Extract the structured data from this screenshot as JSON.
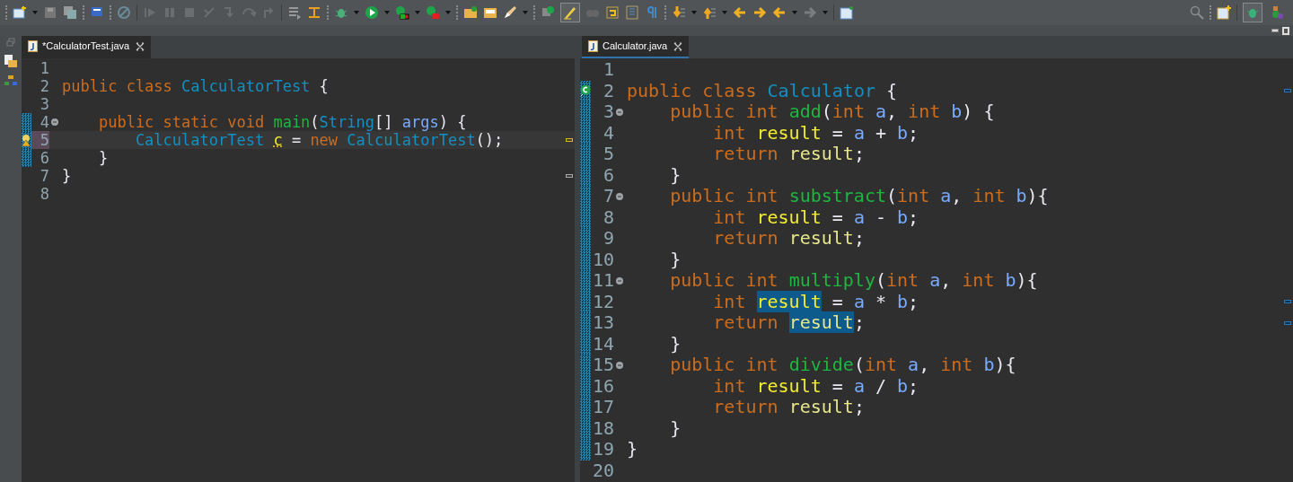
{
  "toolbar": {
    "mark_occurrences": {
      "on": true
    },
    "perspectives": [
      {
        "selected": true
      },
      {
        "selected": false
      }
    ]
  },
  "editors": [
    {
      "tab": {
        "title": "*CalculatorTest.java",
        "active": false
      },
      "kind": "narrow",
      "lines": [
        {
          "number": "1"
        },
        {
          "number": "2",
          "tokens": [
            {
              "kind": "kw",
              "text": "public class "
            },
            {
              "kind": "cls",
              "text": "CalculatorTest"
            },
            {
              "kind": "plain",
              "text": " {"
            }
          ]
        },
        {
          "number": "3"
        },
        {
          "number": "4",
          "foldable": true,
          "changed": true,
          "tokens": [
            {
              "kind": "kw",
              "text": "    public static void "
            },
            {
              "kind": "method",
              "text": "main"
            },
            {
              "kind": "plain",
              "text": "("
            },
            {
              "kind": "cls",
              "text": "String"
            },
            {
              "kind": "plain",
              "text": "[] "
            },
            {
              "kind": "param",
              "text": "args"
            },
            {
              "kind": "plain",
              "text": ") {"
            }
          ]
        },
        {
          "number": "5",
          "current": true,
          "changed": true,
          "marker": {
            "kind": "warning"
          },
          "overview_mark": {
            "kind": "warning"
          },
          "tokens": [
            {
              "kind": "cls",
              "text": "        CalculatorTest "
            },
            {
              "kind": "local",
              "text": "c",
              "warning": true
            },
            {
              "kind": "plain",
              "text": " = "
            },
            {
              "kind": "kw",
              "text": "new "
            },
            {
              "kind": "cls",
              "text": "CalculatorTest"
            },
            {
              "kind": "plain",
              "text": "();"
            }
          ]
        },
        {
          "number": "6",
          "changed": true,
          "tokens": [
            {
              "kind": "plain",
              "text": "    }"
            }
          ]
        },
        {
          "number": "7",
          "overview_mark": {
            "kind": "note"
          },
          "tokens": [
            {
              "kind": "plain",
              "text": "}"
            }
          ]
        },
        {
          "number": "8"
        }
      ]
    },
    {
      "tab": {
        "title": "Calculator.java",
        "active": true
      },
      "kind": "wide",
      "lines": [
        {
          "number": "1"
        },
        {
          "number": "2",
          "changed": true,
          "marker": {
            "kind": "class"
          },
          "overview_mark": {
            "kind": "occurrence"
          },
          "tokens": [
            {
              "kind": "kw",
              "text": "public class "
            },
            {
              "kind": "cls",
              "text": "Calculator"
            },
            {
              "kind": "plain",
              "text": " {"
            }
          ]
        },
        {
          "number": "3",
          "foldable": true,
          "changed": true,
          "tokens": [
            {
              "kind": "kw",
              "text": "    public int "
            },
            {
              "kind": "method",
              "text": "add"
            },
            {
              "kind": "plain",
              "text": "("
            },
            {
              "kind": "kw",
              "text": "int "
            },
            {
              "kind": "param",
              "text": "a"
            },
            {
              "kind": "plain",
              "text": ", "
            },
            {
              "kind": "kw",
              "text": "int "
            },
            {
              "kind": "param",
              "text": "b"
            },
            {
              "kind": "plain",
              "text": ") {"
            }
          ]
        },
        {
          "number": "4",
          "changed": true,
          "tokens": [
            {
              "kind": "kw",
              "text": "        int "
            },
            {
              "kind": "local",
              "text": "result"
            },
            {
              "kind": "plain",
              "text": " = "
            },
            {
              "kind": "param",
              "text": "a"
            },
            {
              "kind": "plain",
              "text": " + "
            },
            {
              "kind": "param",
              "text": "b"
            },
            {
              "kind": "plain",
              "text": ";"
            }
          ]
        },
        {
          "number": "5",
          "changed": true,
          "tokens": [
            {
              "kind": "kw",
              "text": "        return "
            },
            {
              "kind": "ref",
              "text": "result"
            },
            {
              "kind": "plain",
              "text": ";"
            }
          ]
        },
        {
          "number": "6",
          "changed": true,
          "tokens": [
            {
              "kind": "plain",
              "text": "    }"
            }
          ]
        },
        {
          "number": "7",
          "foldable": true,
          "changed": true,
          "tokens": [
            {
              "kind": "kw",
              "text": "    public int "
            },
            {
              "kind": "method",
              "text": "substract"
            },
            {
              "kind": "plain",
              "text": "("
            },
            {
              "kind": "kw",
              "text": "int "
            },
            {
              "kind": "param",
              "text": "a"
            },
            {
              "kind": "plain",
              "text": ", "
            },
            {
              "kind": "kw",
              "text": "int "
            },
            {
              "kind": "param",
              "text": "b"
            },
            {
              "kind": "plain",
              "text": "){"
            }
          ]
        },
        {
          "number": "8",
          "changed": true,
          "tokens": [
            {
              "kind": "kw",
              "text": "        int "
            },
            {
              "kind": "local",
              "text": "result"
            },
            {
              "kind": "plain",
              "text": " = "
            },
            {
              "kind": "param",
              "text": "a"
            },
            {
              "kind": "plain",
              "text": " - "
            },
            {
              "kind": "param",
              "text": "b"
            },
            {
              "kind": "plain",
              "text": ";"
            }
          ]
        },
        {
          "number": "9",
          "changed": true,
          "tokens": [
            {
              "kind": "kw",
              "text": "        return "
            },
            {
              "kind": "ref",
              "text": "result"
            },
            {
              "kind": "plain",
              "text": ";"
            }
          ]
        },
        {
          "number": "10",
          "changed": true,
          "tokens": [
            {
              "kind": "plain",
              "text": "    }"
            }
          ]
        },
        {
          "number": "11",
          "foldable": true,
          "changed": true,
          "tokens": [
            {
              "kind": "kw",
              "text": "    public int "
            },
            {
              "kind": "method",
              "text": "multiply"
            },
            {
              "kind": "plain",
              "text": "("
            },
            {
              "kind": "kw",
              "text": "int "
            },
            {
              "kind": "param",
              "text": "a"
            },
            {
              "kind": "plain",
              "text": ", "
            },
            {
              "kind": "kw",
              "text": "int "
            },
            {
              "kind": "param",
              "text": "b"
            },
            {
              "kind": "plain",
              "text": "){"
            }
          ]
        },
        {
          "number": "12",
          "changed": true,
          "overview_mark": {
            "kind": "occurrence"
          },
          "tokens": [
            {
              "kind": "kw",
              "text": "        int "
            },
            {
              "kind": "local",
              "text": "result",
              "highlighted": true
            },
            {
              "kind": "plain",
              "text": " = "
            },
            {
              "kind": "param",
              "text": "a"
            },
            {
              "kind": "plain",
              "text": " * "
            },
            {
              "kind": "param",
              "text": "b"
            },
            {
              "kind": "plain",
              "text": ";"
            }
          ]
        },
        {
          "number": "13",
          "changed": true,
          "overview_mark": {
            "kind": "occurrence"
          },
          "tokens": [
            {
              "kind": "kw",
              "text": "        return "
            },
            {
              "kind": "ref",
              "text": "result",
              "highlighted": true
            },
            {
              "kind": "plain",
              "text": ";"
            }
          ]
        },
        {
          "number": "14",
          "changed": true,
          "tokens": [
            {
              "kind": "plain",
              "text": "    }"
            }
          ]
        },
        {
          "number": "15",
          "foldable": true,
          "changed": true,
          "tokens": [
            {
              "kind": "kw",
              "text": "    public int "
            },
            {
              "kind": "method",
              "text": "divide"
            },
            {
              "kind": "plain",
              "text": "("
            },
            {
              "kind": "kw",
              "text": "int "
            },
            {
              "kind": "param",
              "text": "a"
            },
            {
              "kind": "plain",
              "text": ", "
            },
            {
              "kind": "kw",
              "text": "int "
            },
            {
              "kind": "param",
              "text": "b"
            },
            {
              "kind": "plain",
              "text": "){"
            }
          ]
        },
        {
          "number": "16",
          "changed": true,
          "tokens": [
            {
              "kind": "kw",
              "text": "        int "
            },
            {
              "kind": "local",
              "text": "result"
            },
            {
              "kind": "plain",
              "text": " = "
            },
            {
              "kind": "param",
              "text": "a"
            },
            {
              "kind": "plain",
              "text": " / "
            },
            {
              "kind": "param",
              "text": "b"
            },
            {
              "kind": "plain",
              "text": ";"
            }
          ]
        },
        {
          "number": "17",
          "changed": true,
          "tokens": [
            {
              "kind": "kw",
              "text": "        return "
            },
            {
              "kind": "ref",
              "text": "result"
            },
            {
              "kind": "plain",
              "text": ";"
            }
          ]
        },
        {
          "number": "18",
          "changed": true,
          "tokens": [
            {
              "kind": "plain",
              "text": "    }"
            }
          ]
        },
        {
          "number": "19",
          "changed": true,
          "tokens": [
            {
              "kind": "plain",
              "text": "}"
            }
          ]
        },
        {
          "number": "20"
        }
      ]
    }
  ]
}
